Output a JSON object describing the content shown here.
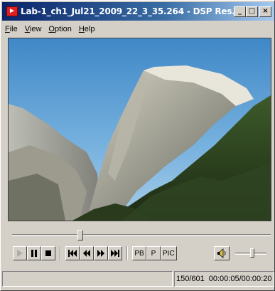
{
  "window": {
    "title": "Lab-1_ch1_Jul21_2009_22_3_35.264 - DSP Res...",
    "app_icon_glyph": "►",
    "minimize_glyph": "_",
    "maximize_glyph": "□",
    "close_glyph": "×"
  },
  "menu": {
    "items": [
      {
        "label": "File",
        "accel": "F",
        "rest": "ile"
      },
      {
        "label": "View",
        "accel": "V",
        "rest": "iew"
      },
      {
        "label": "Option",
        "accel": "O",
        "rest": "ption"
      },
      {
        "label": "Help",
        "accel": "H",
        "rest": "elp"
      }
    ]
  },
  "playback": {
    "seek_position": 0.258,
    "volume_level": 0.55,
    "buttons": {
      "play": "play-icon",
      "pause": "pause-icon",
      "stop": "stop-icon",
      "skip_start": "skip-start-icon",
      "rewind": "rewind-icon",
      "fast_forward": "fast-forward-icon",
      "skip_end": "skip-end-icon",
      "pb_label": "PB",
      "p_label": "P",
      "pic_label": "PIC",
      "speaker": "speaker-icon"
    }
  },
  "status": {
    "left": "",
    "frames": "150/601",
    "time": "00:00:05/00:00:20"
  }
}
